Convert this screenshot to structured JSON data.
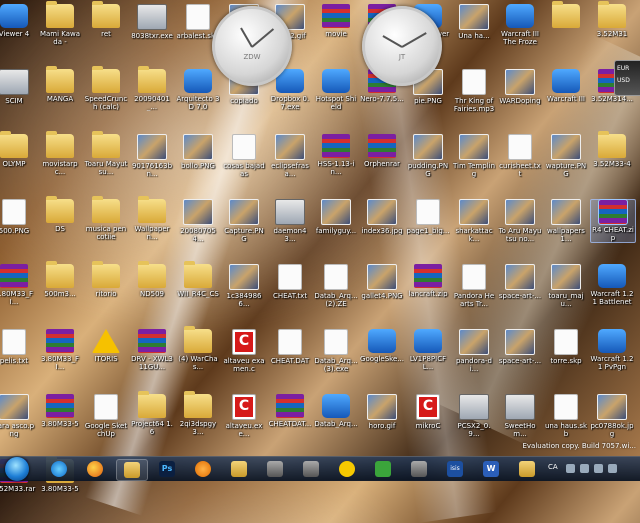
{
  "desktop": {
    "icons": [
      {
        "label": "Viewer 4",
        "kind": "app",
        "icon_name": "viewer-icon"
      },
      {
        "label": "Mami Kawada -",
        "kind": "folder",
        "icon_name": "folder-icon"
      },
      {
        "label": "ret",
        "kind": "folder",
        "icon_name": "folder-icon"
      },
      {
        "label": "8038txr.exe",
        "kind": "exe",
        "icon_name": "exe-icon"
      },
      {
        "label": "arbalest.skp",
        "kind": "doc",
        "icon_name": "sketchup-file-icon"
      },
      {
        "label": "",
        "kind": "image",
        "icon_name": "image-icon"
      },
      {
        "label": "horo2.gif",
        "kind": "image",
        "icon_name": "image-icon"
      },
      {
        "label": "movie",
        "kind": "archive",
        "icon_name": "winrar-archive-icon"
      },
      {
        "label": "",
        "kind": "archive",
        "icon_name": "winrar-archive-icon"
      },
      {
        "label": "TeamViewer",
        "kind": "app",
        "icon_name": "teamviewer-icon"
      },
      {
        "label": "Una ha...",
        "kind": "image",
        "icon_name": "image-icon"
      },
      {
        "label": "Warcraft III The Frozen...",
        "kind": "app",
        "icon_name": "warcraft-icon"
      },
      {
        "label": "",
        "kind": "folder",
        "icon_name": "folder-icon"
      },
      {
        "label": "3.52M31",
        "kind": "folder",
        "icon_name": "folder-icon"
      },
      {
        "label": "SCIM",
        "kind": "exe",
        "icon_name": "exe-icon"
      },
      {
        "label": "MANGA",
        "kind": "folder",
        "icon_name": "folder-icon"
      },
      {
        "label": "SpeedCrunch (calc)",
        "kind": "folder",
        "icon_name": "folder-icon"
      },
      {
        "label": "20090401_...",
        "kind": "folder",
        "icon_name": "folder-icon"
      },
      {
        "label": "Arquitecto 3D 7.0",
        "kind": "app",
        "icon_name": "arquitecto-3d-icon"
      },
      {
        "label": "copiado",
        "kind": "image",
        "icon_name": "image-icon"
      },
      {
        "label": "Dropbox 0.7.exe",
        "kind": "app",
        "icon_name": "dropbox-icon"
      },
      {
        "label": "Hotspot Shield",
        "kind": "app",
        "icon_name": "hotspot-shield-icon"
      },
      {
        "label": "Nero-7.7.5...",
        "kind": "archive",
        "icon_name": "winrar-archive-icon"
      },
      {
        "label": "pie.PNG",
        "kind": "image",
        "icon_name": "image-icon"
      },
      {
        "label": "Thr King of Fairies.mp3",
        "kind": "doc",
        "icon_name": "audio-file-icon"
      },
      {
        "label": "WARDoping",
        "kind": "image",
        "icon_name": "image-icon"
      },
      {
        "label": "Warcraft III",
        "kind": "app",
        "icon_name": "warcraft-icon"
      },
      {
        "label": "3.52M314...",
        "kind": "archive",
        "icon_name": "winrar-archive-icon"
      },
      {
        "label": "OLYMP",
        "kind": "folder",
        "icon_name": "folder-icon"
      },
      {
        "label": "movistarpc...",
        "kind": "folder",
        "icon_name": "folder-icon"
      },
      {
        "label": "Toaru Mayutsu...",
        "kind": "folder",
        "icon_name": "folder-icon"
      },
      {
        "label": "90176163bn...",
        "kind": "image",
        "icon_name": "image-icon"
      },
      {
        "label": "bollo.PNG",
        "kind": "image",
        "icon_name": "image-icon"
      },
      {
        "label": "cosas bajadas",
        "kind": "doc",
        "icon_name": "document-icon"
      },
      {
        "label": "eclipsefrasa...",
        "kind": "image",
        "icon_name": "image-icon"
      },
      {
        "label": "HSS-1.13-in...",
        "kind": "archive",
        "icon_name": "winrar-archive-icon"
      },
      {
        "label": "Orphenrar",
        "kind": "archive",
        "icon_name": "winrar-archive-icon"
      },
      {
        "label": "pudding.PNG",
        "kind": "image",
        "icon_name": "image-icon"
      },
      {
        "label": "Tim Templing",
        "kind": "image",
        "icon_name": "image-icon"
      },
      {
        "label": "curisheet.txt",
        "kind": "doc",
        "icon_name": "text-file-icon"
      },
      {
        "label": "wapture.PNG",
        "kind": "image",
        "icon_name": "image-icon"
      },
      {
        "label": "3.52M33-4",
        "kind": "folder",
        "icon_name": "folder-icon"
      },
      {
        "label": "500.PNG",
        "kind": "doc",
        "icon_name": "image-file-icon"
      },
      {
        "label": "DS",
        "kind": "folder",
        "icon_name": "folder-icon"
      },
      {
        "label": "musica pen cotiie",
        "kind": "folder",
        "icon_name": "folder-icon"
      },
      {
        "label": "Wallpapern...",
        "kind": "folder",
        "icon_name": "folder-icon"
      },
      {
        "label": "200807054...",
        "kind": "image",
        "icon_name": "image-icon"
      },
      {
        "label": "Capture.PNG",
        "kind": "image",
        "icon_name": "image-icon"
      },
      {
        "label": "daemon43...",
        "kind": "exe",
        "icon_name": "installer-icon"
      },
      {
        "label": "familyguy...",
        "kind": "image",
        "icon_name": "image-icon"
      },
      {
        "label": "index36.jpg",
        "kind": "image",
        "icon_name": "image-icon"
      },
      {
        "label": "page1_big...",
        "kind": "doc",
        "icon_name": "document-icon"
      },
      {
        "label": "sharkattack...",
        "kind": "image",
        "icon_name": "image-icon"
      },
      {
        "label": "To Aru Mayutsu no...",
        "kind": "image",
        "icon_name": "image-icon"
      },
      {
        "label": "wallpapers1...",
        "kind": "image",
        "icon_name": "image-icon"
      },
      {
        "label": "R4 CHEAT.zip",
        "kind": "archive",
        "icon_name": "winrar-archive-icon",
        "selected": true
      },
      {
        "label": "3.80M33_FI...",
        "kind": "archive",
        "icon_name": "winrar-archive-icon"
      },
      {
        "label": "500m3...",
        "kind": "folder",
        "icon_name": "folder-icon"
      },
      {
        "label": "ritorio",
        "kind": "folder",
        "icon_name": "folder-icon"
      },
      {
        "label": "ND509",
        "kind": "folder",
        "icon_name": "folder-icon"
      },
      {
        "label": "WII_R4C_CS",
        "kind": "folder",
        "icon_name": "folder-icon"
      },
      {
        "label": "1c3849866...",
        "kind": "image",
        "icon_name": "image-icon"
      },
      {
        "label": "CHEAT.txt",
        "kind": "doc",
        "icon_name": "text-file-icon"
      },
      {
        "label": "Datab_Arq... (2).ZE",
        "kind": "doc",
        "icon_name": "document-icon"
      },
      {
        "label": "gallet4.PNG",
        "kind": "image",
        "icon_name": "image-icon"
      },
      {
        "label": "lancraft.zip",
        "kind": "archive",
        "icon_name": "winrar-archive-icon"
      },
      {
        "label": "Pandora Hearts Tr...",
        "kind": "doc",
        "icon_name": "audio-file-icon"
      },
      {
        "label": "space-art-...",
        "kind": "image",
        "icon_name": "image-icon"
      },
      {
        "label": "toaru_maju...",
        "kind": "image",
        "icon_name": "image-icon"
      },
      {
        "label": "Warcraft 1.21 Battlenet",
        "kind": "app",
        "icon_name": "warcraft-icon"
      },
      {
        "label": "pelis.txt",
        "kind": "doc",
        "icon_name": "text-file-icon"
      },
      {
        "label": "3.80M33_FI...",
        "kind": "archive",
        "icon_name": "winrar-archive-icon"
      },
      {
        "label": "ITORIS",
        "kind": "warn",
        "icon_name": "warning-icon"
      },
      {
        "label": "DRV - XWL311GU...",
        "kind": "archive",
        "icon_name": "winrar-archive-icon"
      },
      {
        "label": "(4) WarChas...",
        "kind": "folder",
        "icon_name": "folder-icon"
      },
      {
        "label": "altaveu examen.c",
        "kind": "pdf",
        "icon_name": "pdf-icon"
      },
      {
        "label": "CHEAT.DAT",
        "kind": "doc",
        "icon_name": "document-icon"
      },
      {
        "label": "Datab_Arq... (3).exe",
        "kind": "doc",
        "icon_name": "document-icon"
      },
      {
        "label": "GoogleSke...",
        "kind": "app",
        "icon_name": "google-sketchup-icon"
      },
      {
        "label": "LV1P8PICFL...",
        "kind": "app",
        "icon_name": "lv-pic-icon"
      },
      {
        "label": "pandora-di...",
        "kind": "image",
        "icon_name": "image-icon"
      },
      {
        "label": "space-art-...",
        "kind": "image",
        "icon_name": "image-icon"
      },
      {
        "label": "torre.skp",
        "kind": "doc",
        "icon_name": "sketchup-file-icon"
      },
      {
        "label": "Warcraft 1.21 PvPgn",
        "kind": "app",
        "icon_name": "warcraft-icon"
      },
      {
        "label": "cara asco.png",
        "kind": "image",
        "icon_name": "image-icon"
      },
      {
        "label": "3.80M33-5",
        "kind": "archive",
        "icon_name": "winrar-archive-icon"
      },
      {
        "label": "Google SketchUp",
        "kind": "doc",
        "icon_name": "document-icon"
      },
      {
        "label": "Project64 1.6",
        "kind": "folder",
        "icon_name": "folder-icon"
      },
      {
        "label": "2qi3dspgy3...",
        "kind": "folder",
        "icon_name": "folder-icon"
      },
      {
        "label": "altaveu.exe...",
        "kind": "pdf",
        "icon_name": "pdf-icon"
      },
      {
        "label": "CHEATDAT...",
        "kind": "archive",
        "icon_name": "winrar-archive-icon"
      },
      {
        "label": "Datab_Arq...",
        "kind": "app",
        "icon_name": "disc-icon"
      },
      {
        "label": "horo.gif",
        "kind": "image",
        "icon_name": "image-icon"
      },
      {
        "label": "mikroC",
        "kind": "pdf",
        "icon_name": "pdf-icon"
      },
      {
        "label": "PCSX2_0.9...",
        "kind": "exe",
        "icon_name": "installer-icon"
      },
      {
        "label": "SweetHom...",
        "kind": "exe",
        "icon_name": "installer-icon"
      },
      {
        "label": "una haus.skb",
        "kind": "doc",
        "icon_name": "sketchup-file-icon"
      },
      {
        "label": "pc0788ok.jpg",
        "kind": "image",
        "icon_name": "image-icon"
      },
      {
        "label": "3.52M33.rar",
        "kind": "archive",
        "icon_name": "winrar-archive-icon"
      },
      {
        "label": "3.80M33-5",
        "kind": "folder",
        "icon_name": "folder-icon"
      }
    ]
  },
  "clocks": [
    {
      "city": "ZDW"
    },
    {
      "city": "JT"
    }
  ],
  "currency_widget": {
    "line1": "EUR",
    "line2": "USD"
  },
  "taskbar": {
    "items": [
      {
        "icon_name": "internet-explorer-icon",
        "style": "ie",
        "text": ""
      },
      {
        "icon_name": "firefox-icon",
        "style": "ff",
        "text": ""
      },
      {
        "icon_name": "windows-explorer-icon",
        "style": "ex",
        "text": "",
        "active": true
      },
      {
        "icon_name": "photoshop-icon",
        "style": "ps",
        "text": "Ps"
      },
      {
        "icon_name": "media-player-icon",
        "style": "wmp",
        "text": ""
      },
      {
        "icon_name": "folder-taskbar-icon",
        "style": "ex",
        "text": ""
      },
      {
        "icon_name": "network-icon",
        "style": "gen",
        "text": ""
      },
      {
        "icon_name": "tool-icon",
        "style": "gen",
        "text": ""
      },
      {
        "icon_name": "yellow-app-icon",
        "style": "yel",
        "text": ""
      },
      {
        "icon_name": "spotify-icon",
        "style": "grn",
        "text": ""
      },
      {
        "icon_name": "game-icon",
        "style": "gen",
        "text": ""
      },
      {
        "icon_name": "isis-icon",
        "style": "isis",
        "text": "isis"
      },
      {
        "icon_name": "word-icon",
        "style": "word",
        "text": "W"
      },
      {
        "icon_name": "folder-pinned-icon",
        "style": "ex",
        "text": ""
      }
    ],
    "tray": {
      "language": "CA"
    }
  },
  "watermark": {
    "text": "Evaluation copy. Build 7057.wi..."
  }
}
